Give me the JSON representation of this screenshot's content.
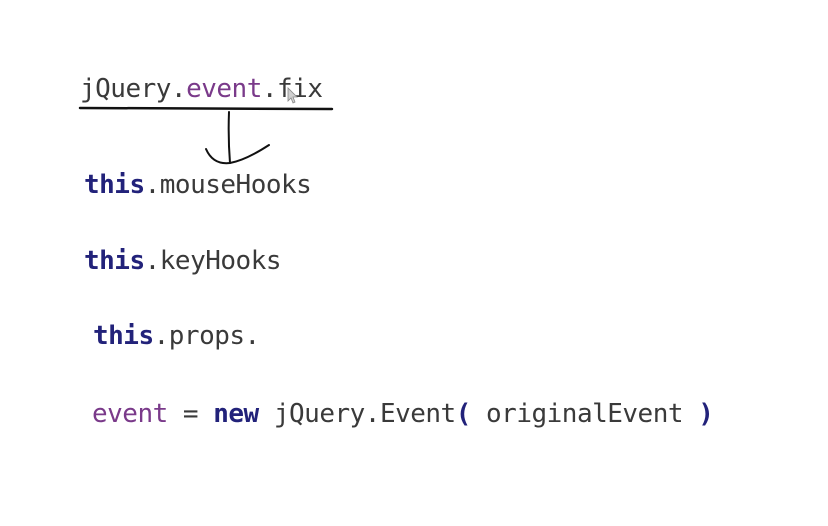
{
  "lines": [
    {
      "obj": "jQuery",
      "dot1": ".",
      "mid": "event",
      "dot2": ".",
      "tail": "fix"
    },
    {
      "kw": "this",
      "dot": ".",
      "prop": "mouseHooks"
    },
    {
      "kw": "this",
      "dot": ".",
      "prop": "keyHooks"
    },
    {
      "kw": "this",
      "dot": ".",
      "prop": "props."
    },
    {
      "var": "event",
      "eq": " = ",
      "kw": "new",
      "rest": " jQuery.Event",
      "open": "(",
      "arg": " originalEvent ",
      "close": ")"
    }
  ],
  "colors": {
    "text": "#3a3a3a",
    "keyword": "#22227a",
    "variable": "#7a3a8a",
    "annotation": "#111111"
  }
}
